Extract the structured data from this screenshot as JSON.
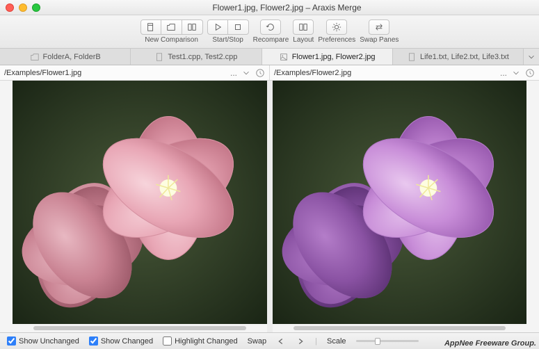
{
  "window": {
    "title": "Flower1.jpg, Flower2.jpg – Araxis Merge"
  },
  "toolbar": {
    "newComparison": "New Comparison",
    "startStop": "Start/Stop",
    "recompare": "Recompare",
    "layout": "Layout",
    "preferences": "Preferences",
    "swapPanes": "Swap Panes"
  },
  "tabs": [
    {
      "label": "FolderA, FolderB",
      "icon": "folder-icon",
      "active": false
    },
    {
      "label": "Test1.cpp, Test2.cpp",
      "icon": "file-icon",
      "active": false
    },
    {
      "label": "Flower1.jpg, Flower2.jpg",
      "icon": "image-icon",
      "active": true
    },
    {
      "label": "Life1.txt, Life2.txt, Life3.txt",
      "icon": "file-icon",
      "active": false
    }
  ],
  "leftPane": {
    "path": "/Examples/Flower1.jpg",
    "more": "..."
  },
  "rightPane": {
    "path": "/Examples/Flower2.jpg",
    "more": "..."
  },
  "bottom": {
    "showUnchanged": "Show Unchanged",
    "showChanged": "Show Changed",
    "highlightChanged": "Highlight Changed",
    "swap": "Swap",
    "scale": "Scale"
  },
  "checkboxes": {
    "showUnchanged": true,
    "showChanged": true,
    "highlightChanged": false
  },
  "watermark": "AppNee Freeware Group."
}
